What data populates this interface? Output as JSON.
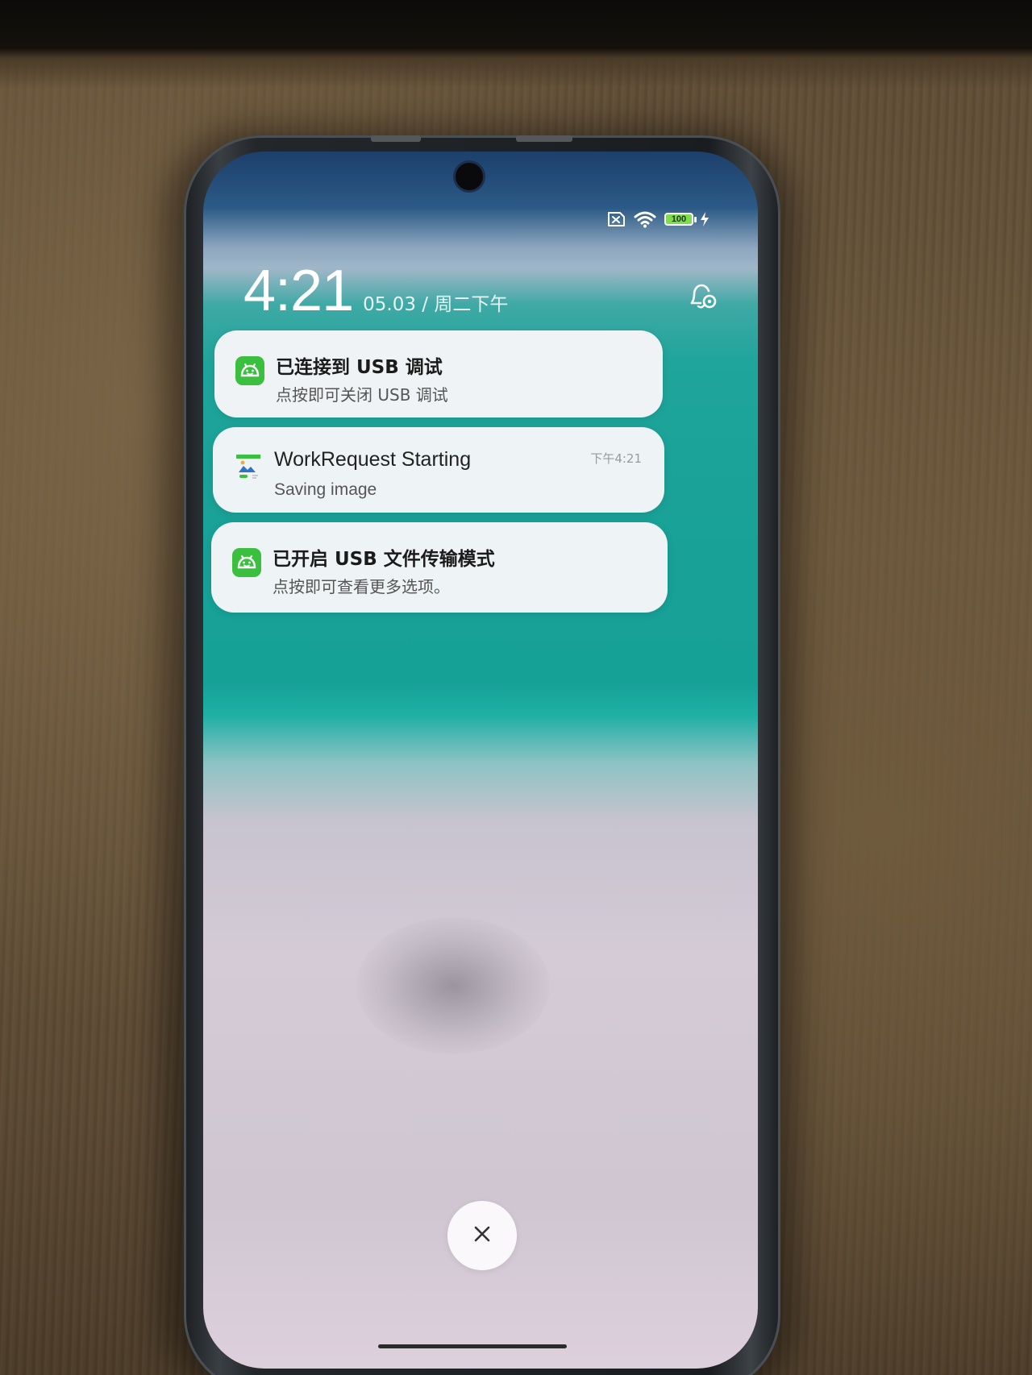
{
  "status_bar": {
    "sim_icon": "no-sim-icon",
    "wifi_icon": "wifi-icon",
    "battery_level": "100",
    "charging_icon": "lightning-icon"
  },
  "lockscreen": {
    "time": "4:21",
    "date": "05.03 / 周二下午",
    "settings_icon": "bell-gear-icon"
  },
  "notifications": [
    {
      "icon": "android-icon",
      "title": "已连接到 USB 调试",
      "text": "点按即可关闭 USB 调试",
      "time": ""
    },
    {
      "icon": "image-app-icon",
      "title": "WorkRequest Starting",
      "text": "Saving image",
      "time": "下午4:21"
    },
    {
      "icon": "android-icon",
      "title": "已开启 USB 文件传输模式",
      "text": "点按即可查看更多选项。",
      "time": ""
    }
  ],
  "controls": {
    "close_icon": "close-icon"
  },
  "colors": {
    "android_green": "#3bbf3f",
    "battery_green": "#7fdc4f",
    "teal_wallpaper": "#18a197"
  }
}
